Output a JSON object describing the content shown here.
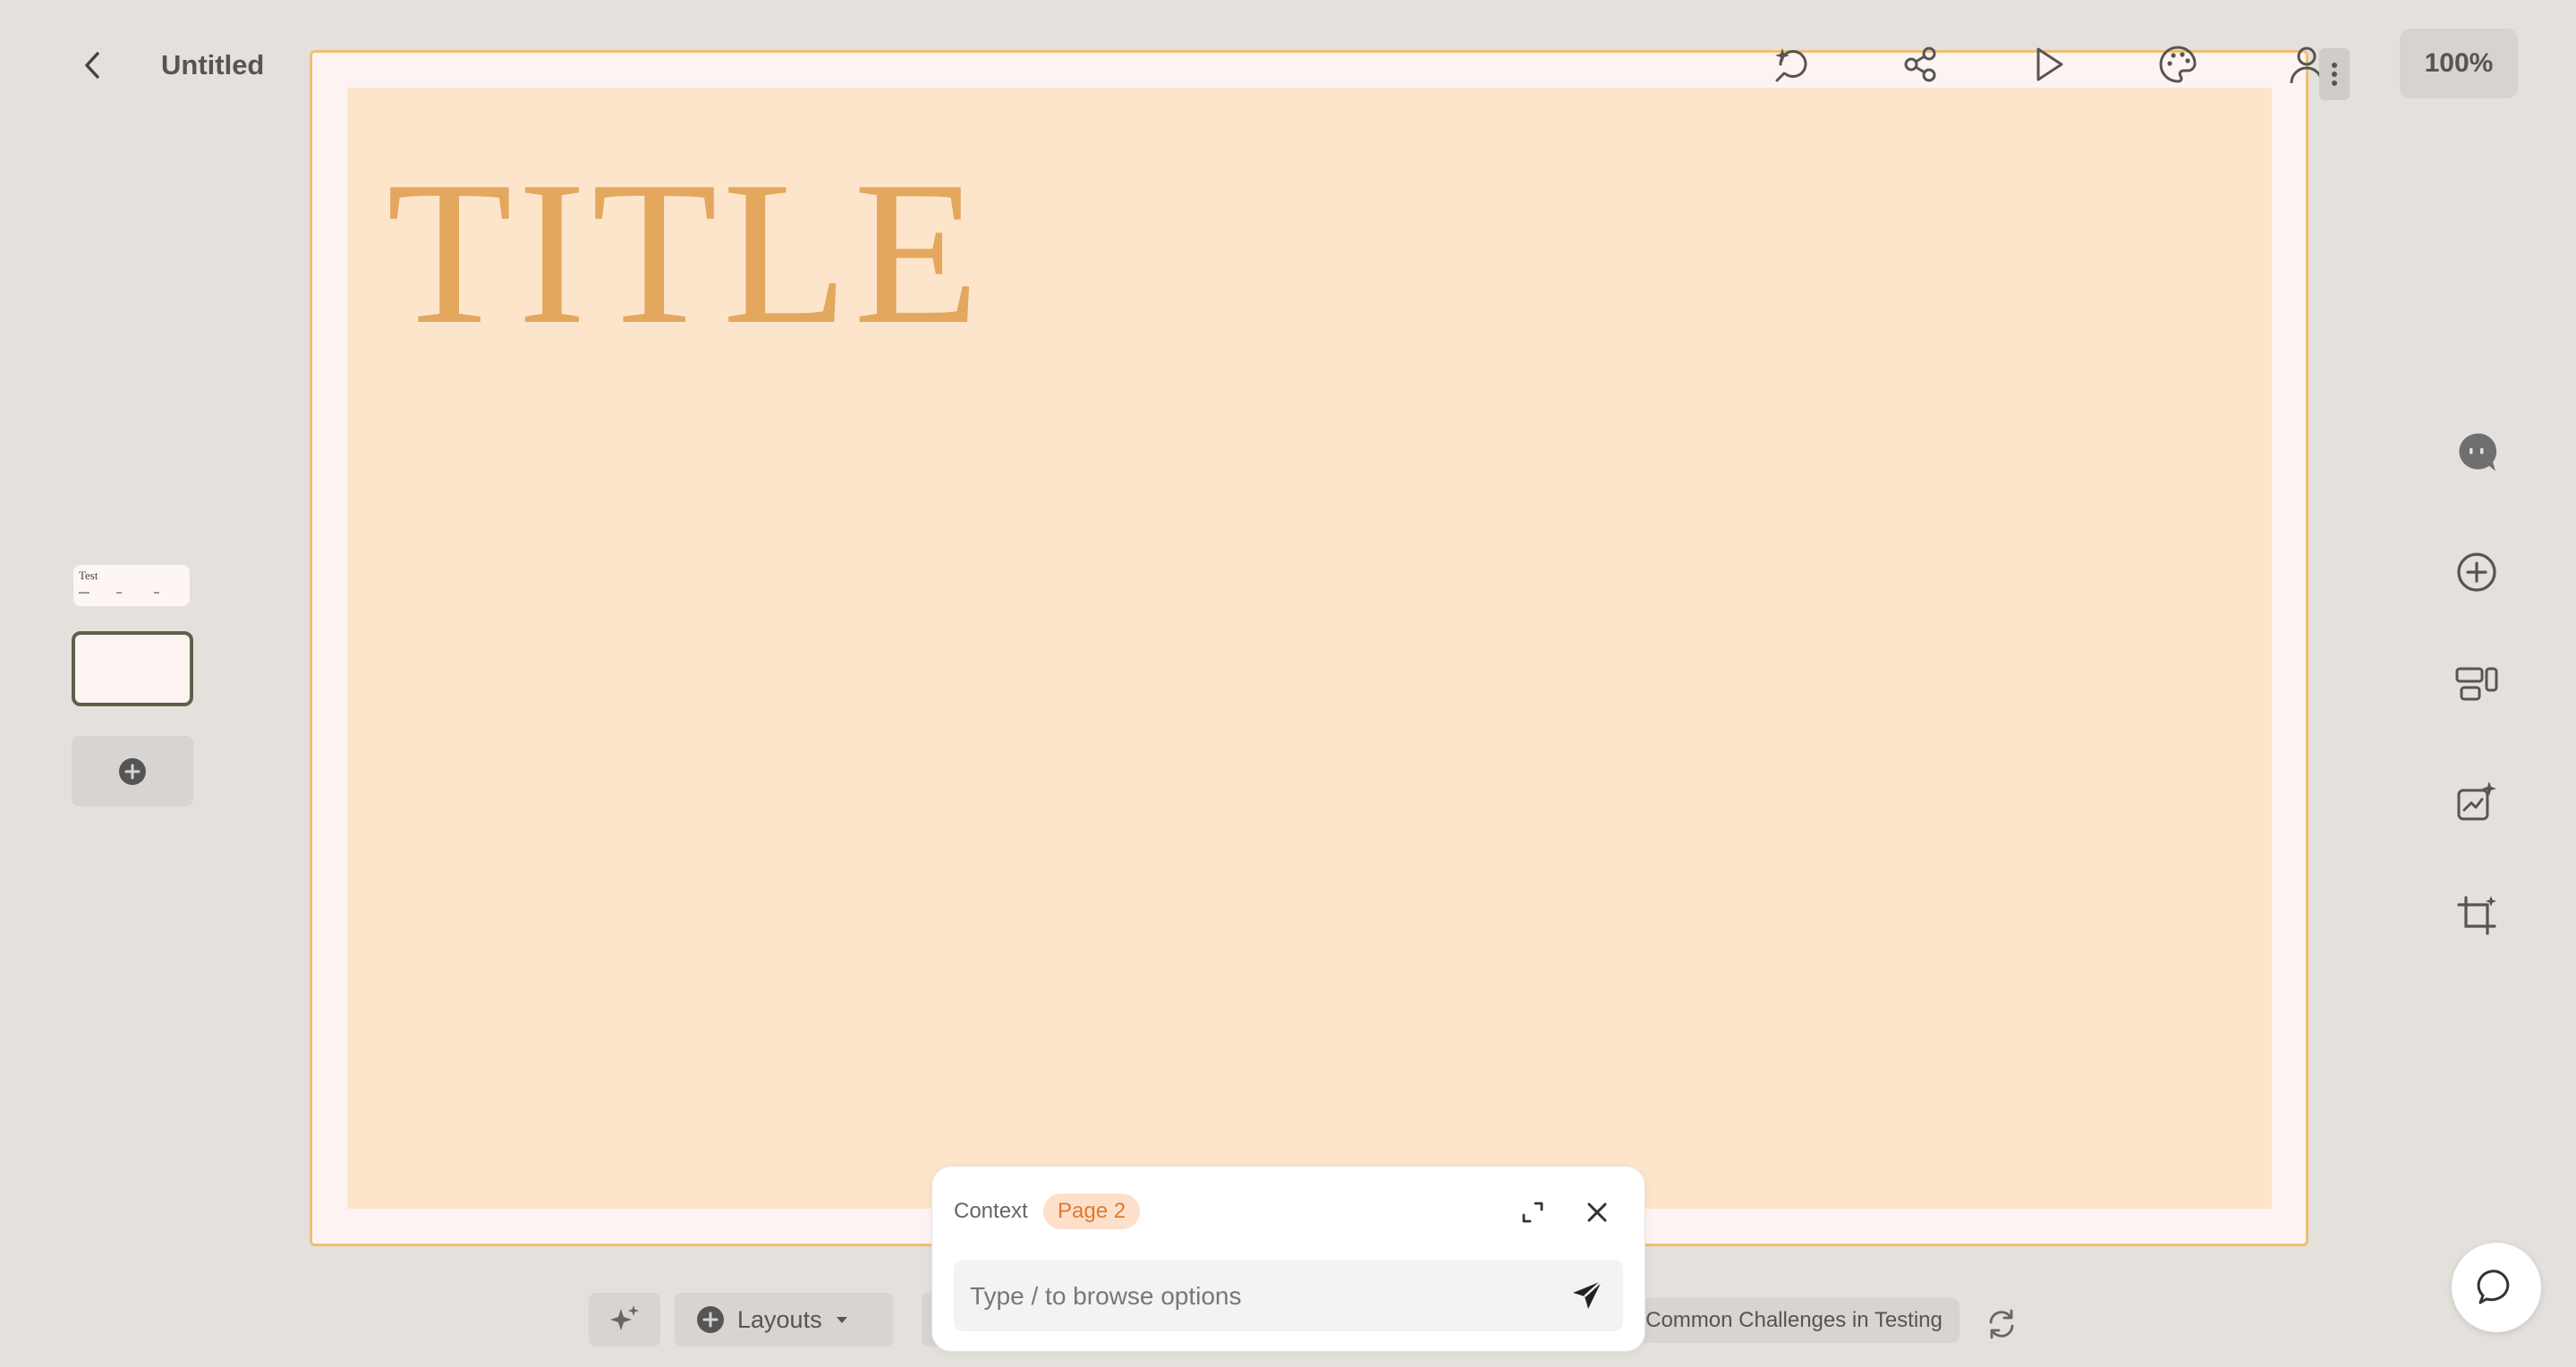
{
  "header": {
    "doc_title": "Untitled",
    "zoom": "100%",
    "icons": [
      "back-icon",
      "cloud-upload-icon",
      "history-icon",
      "share-icon",
      "play-icon",
      "palette-icon",
      "user-icon",
      "more-vertical-icon"
    ]
  },
  "slide": {
    "title": "TITLE",
    "colors": {
      "frame_border": "#f0bf72",
      "background": "#fde5cb",
      "title": "#e3a75e"
    }
  },
  "thumbnails": [
    {
      "title": "Test",
      "selected": false
    },
    {
      "title": "",
      "selected": true
    }
  ],
  "right_tools": [
    "ai-chat-icon",
    "add-circle-icon",
    "layout-icon",
    "chart-sparkle-icon",
    "crop-sparkle-icon",
    "chat-bubble-icon"
  ],
  "bottom_toolbar": {
    "layouts_label": "Layouts",
    "topic_label": "Common Challenges in Testing"
  },
  "ai_panel": {
    "context_label": "Context",
    "context_chip": "Page 2",
    "input_placeholder": "Type / to browse options",
    "input_value": ""
  }
}
